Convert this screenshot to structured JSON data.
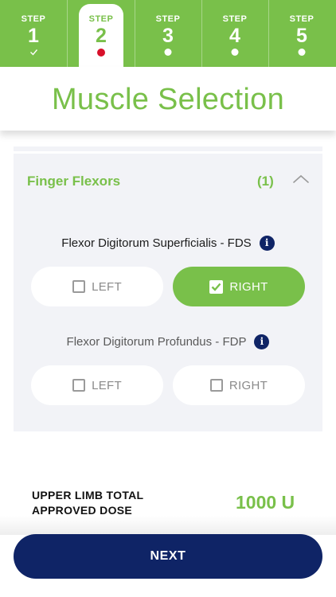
{
  "stepper": {
    "steps": [
      {
        "label": "STEP",
        "number": "1",
        "state": "done"
      },
      {
        "label": "STEP",
        "number": "2",
        "state": "current"
      },
      {
        "label": "STEP",
        "number": "3",
        "state": "pending"
      },
      {
        "label": "STEP",
        "number": "4",
        "state": "pending"
      },
      {
        "label": "STEP",
        "number": "5",
        "state": "pending"
      }
    ]
  },
  "header": {
    "title": "Muscle Selection"
  },
  "group": {
    "title": "Finger Flexors",
    "count": "(1)",
    "expanded": true,
    "muscles": [
      {
        "name": "Flexor Digitorum Superficialis - FDS",
        "info_icon": "info-icon",
        "left": {
          "label": "LEFT",
          "checked": false
        },
        "right": {
          "label": "RIGHT",
          "checked": true
        }
      },
      {
        "name": "Flexor Digitorum Profundus - FDP",
        "info_icon": "info-icon",
        "left": {
          "label": "LEFT",
          "checked": false
        },
        "right": {
          "label": "RIGHT",
          "checked": false
        }
      }
    ]
  },
  "dose": {
    "label_line1": "UPPER LIMB TOTAL",
    "label_line2": "APPROVED DOSE",
    "value": "1000 U"
  },
  "footer": {
    "next_label": "NEXT"
  },
  "colors": {
    "accent": "#79c04a",
    "navy": "#0f2466",
    "current_step_dot": "#d8102a",
    "panel_bg": "#f2f3f7"
  }
}
